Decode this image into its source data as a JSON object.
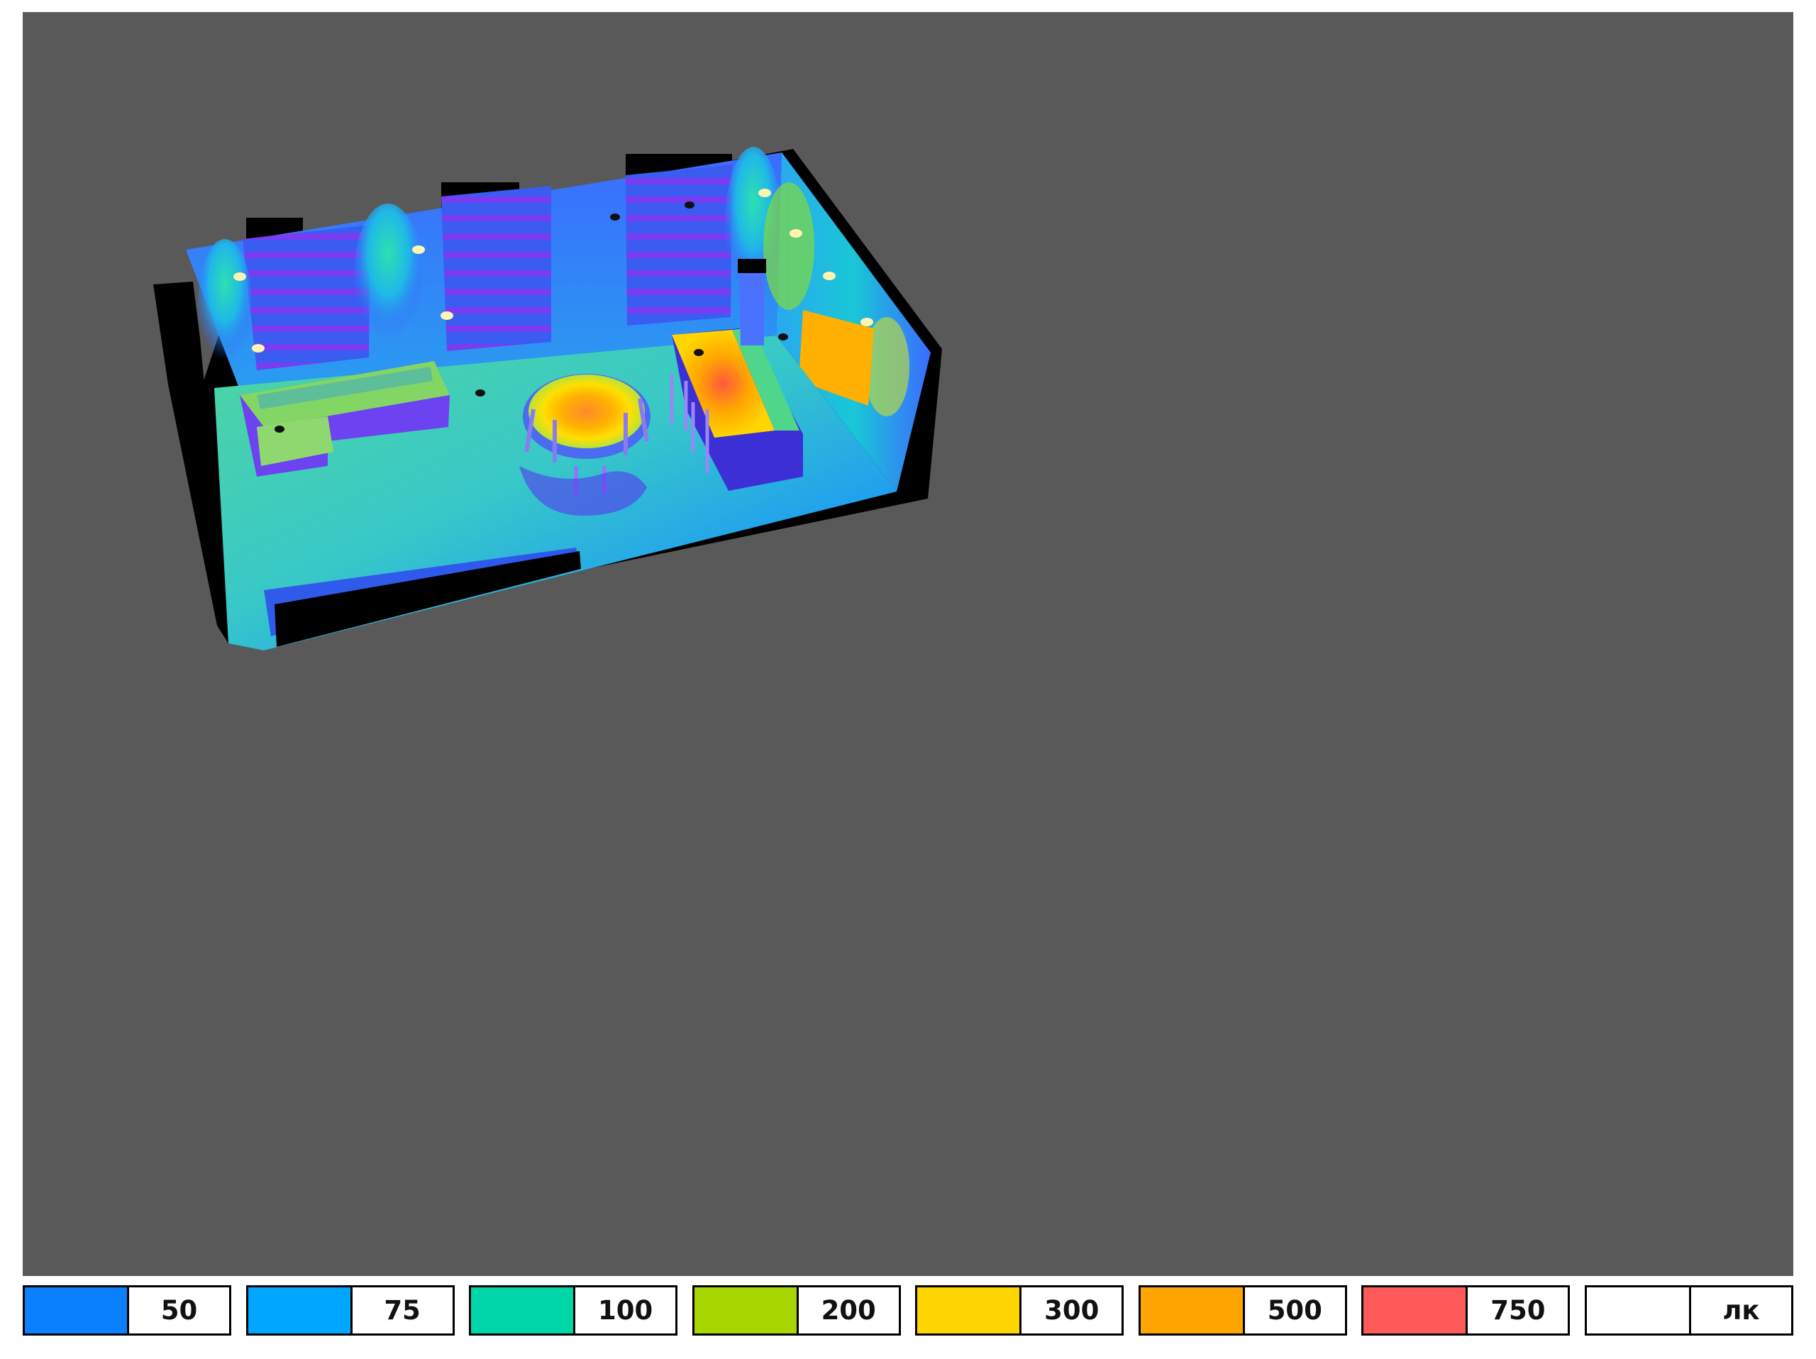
{
  "legend": {
    "items": [
      {
        "label": "50",
        "color": "#0a80ff"
      },
      {
        "label": "75",
        "color": "#00a6ff"
      },
      {
        "label": "100",
        "color": "#00d6a8"
      },
      {
        "label": "200",
        "color": "#a8d600"
      },
      {
        "label": "300",
        "color": "#ffd500"
      },
      {
        "label": "500",
        "color": "#ffa600"
      },
      {
        "label": "750",
        "color": "#ff5a5a"
      },
      {
        "label": "лк",
        "color": "#ffffff"
      }
    ]
  },
  "scene": {
    "background": "#595959",
    "wall_color": "#000000",
    "palette": {
      "low": "#3d1fd6",
      "mid_low": "#2f6bff",
      "mid": "#1fb2e6",
      "mid_high": "#5fd88a",
      "high": "#ffd500",
      "peak": "#ff5a2a"
    },
    "fixtures": [
      "ceiling-light-icon"
    ]
  }
}
